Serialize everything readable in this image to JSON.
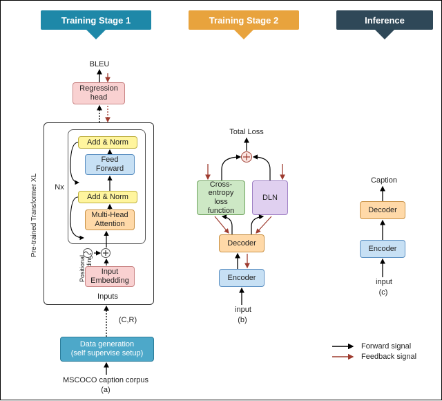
{
  "banners": {
    "stage1": {
      "label": "Training Stage 1",
      "color": "#1E88A8"
    },
    "stage2": {
      "label": "Training Stage 2",
      "color": "#E8A33D"
    },
    "inference": {
      "label": "Inference",
      "color": "#2F4858"
    }
  },
  "col_a": {
    "top_text": "BLEU",
    "reg_head": "Regression\nhead",
    "add_norm1": "Add & Norm",
    "feed_forward": "Feed\nForward",
    "add_norm2": "Add & Norm",
    "mha": "Multi-Head\nAttention",
    "nx": "Nx",
    "pos_enc": "Positional\nEncoding",
    "input_emb": "Input\nEmbedding",
    "inputs": "Inputs",
    "cr": "(C,R)",
    "datagen": "Data generation\n(self supervise setup)",
    "corpus": "MSCOCO caption corpus",
    "sub": "(a)",
    "sidebar": "Pre-trained Transformer XL"
  },
  "col_b": {
    "total_loss": "Total Loss",
    "ce": "Cross-\nentropy loss\nfunction",
    "dln": "DLN",
    "decoder": "Decoder",
    "encoder": "Encoder",
    "input": "input",
    "sub": "(b)"
  },
  "col_c": {
    "caption": "Caption",
    "decoder": "Decoder",
    "encoder": "Encoder",
    "input": "input",
    "sub": "(c)"
  },
  "legend": {
    "forward": "Forward signal",
    "feedback": "Feedback signal"
  },
  "colors": {
    "reg_head": {
      "fill": "#F9D1D1",
      "stroke": "#C98484"
    },
    "add_norm": {
      "fill": "#FFF59E",
      "stroke": "#BDAF3F"
    },
    "feed_forward": {
      "fill": "#C7E0F4",
      "stroke": "#5A8FC2"
    },
    "mha": {
      "fill": "#FFD9A8",
      "stroke": "#C99246"
    },
    "input_emb": {
      "fill": "#F9D1D1",
      "stroke": "#C98484"
    },
    "datagen": {
      "fill": "#4DA8C9",
      "stroke": "#2A7B99",
      "text": "#fff"
    },
    "ce": {
      "fill": "#CDE8C5",
      "stroke": "#6FA35E"
    },
    "dln": {
      "fill": "#E0D0F0",
      "stroke": "#9E7FC4"
    },
    "decoder": {
      "fill": "#FFD9A8",
      "stroke": "#C99246"
    },
    "encoder": {
      "fill": "#C7E0F4",
      "stroke": "#5A8FC2"
    },
    "feedback": "#9E3B2F"
  }
}
